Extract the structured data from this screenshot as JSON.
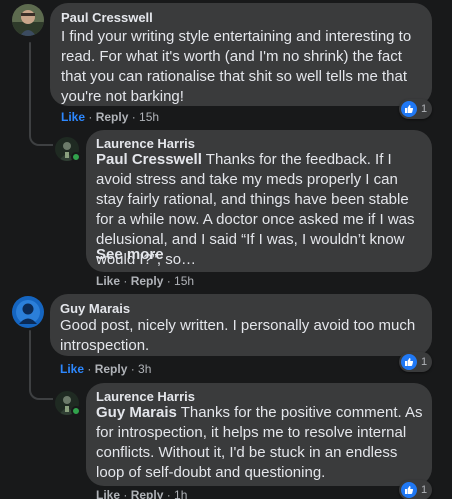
{
  "comments": [
    {
      "author": "Paul Cresswell",
      "text": "I find your writing style entertaining and interesting to read. For what it's worth (and I'm no shrink) the fact that you can rationalise that shit so well tells me that you're not barking!",
      "like_label": "Like",
      "reply_label": "Reply",
      "time": "15h",
      "reaction_count": "1",
      "reply": {
        "author": "Laurence Harris",
        "mention": "Paul Cresswell",
        "text": " Thanks for the feedback. If I avoid stress and take my meds properly I can stay fairly rational, and things have been stable for a while now. A doctor once asked me if I was delusional, and I said “If I was, I wouldn’t know would I?”, so…",
        "see_more": "See more",
        "like_label": "Like",
        "reply_label": "Reply",
        "time": "15h"
      }
    },
    {
      "author": "Guy Marais",
      "text": "Good post, nicely written. I personally avoid too much introspection.",
      "like_label": "Like",
      "reply_label": "Reply",
      "time": "3h",
      "reaction_count": "1",
      "reply": {
        "author": "Laurence Harris",
        "mention": "Guy Marais",
        "text": " Thanks for the positive comment. As for introspection, it helps me to resolve internal conflicts. Without it, I'd be stuck in an endless loop of self-doubt and questioning.",
        "like_label": "Like",
        "reply_label": "Reply",
        "time": "1h",
        "reaction_count": "1"
      }
    }
  ],
  "separator": " · ",
  "colors": {
    "background": "#18191a",
    "bubble": "#3a3b3c",
    "text": "#e4e6eb",
    "secondary": "#b0b3b8",
    "link": "#2d88ff",
    "like_badge": "#2078f4",
    "online": "#31a24c"
  }
}
